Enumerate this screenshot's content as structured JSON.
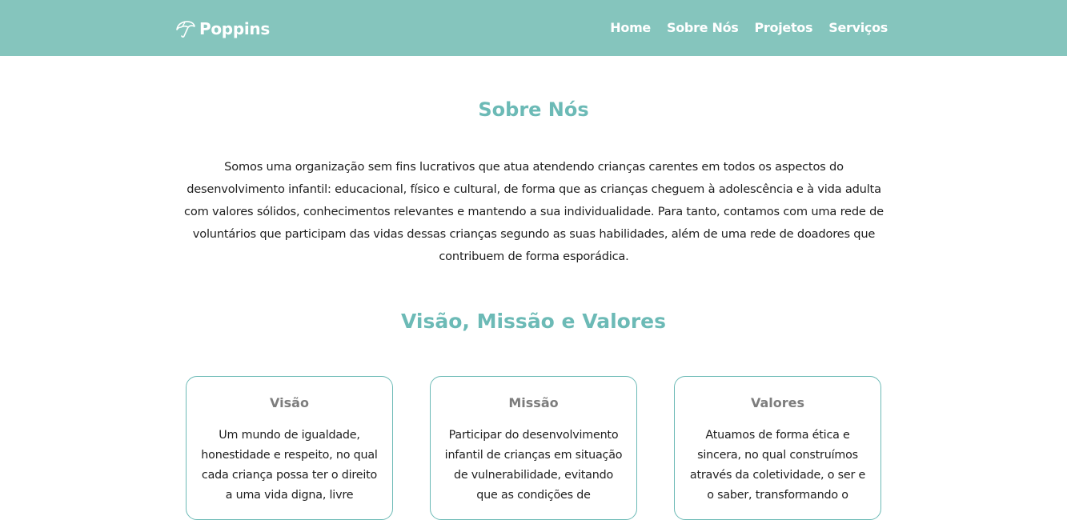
{
  "navbar": {
    "brand": {
      "icon": "umbrella-icon",
      "name": "Poppins"
    },
    "links": [
      "Home",
      "Sobre Nós",
      "Projetos",
      "Serviços"
    ]
  },
  "about": {
    "title": "Sobre Nós",
    "text": "Somos uma organização sem fins lucrativos que atua atendendo crianças carentes em todos os aspectos do desenvolvimento infantil: educacional, físico e cultural, de forma que as crianças cheguem à adolescência e à vida adulta com valores sólidos, conhecimentos relevantes e mantendo a sua individualidade. Para tanto, contamos com uma rede de voluntários que participam das vidas dessas crianças segundo as suas habilidades, além de uma rede de doadores que contribuem de forma esporádica."
  },
  "vmv": {
    "title": "Visão, Missão e Valores",
    "cards": [
      {
        "title": "Visão",
        "text": "Um mundo de igualdade, honestidade e respeito, no qual cada criança possa ter o direito a uma vida digna, livre"
      },
      {
        "title": "Missão",
        "text": "Participar do desenvolvimento infantil de crianças em situação de vulnerabilidade, evitando que as condições de"
      },
      {
        "title": "Valores",
        "text": "Atuamos de forma ética e sincera, no qual construímos através da coletividade, o ser e o saber, transformando o"
      }
    ]
  },
  "colors": {
    "navbar_bg": "#85c5bd",
    "accent": "#6cbab6",
    "card_title": "#7d7d7d",
    "body_text": "#1e1e1e"
  }
}
